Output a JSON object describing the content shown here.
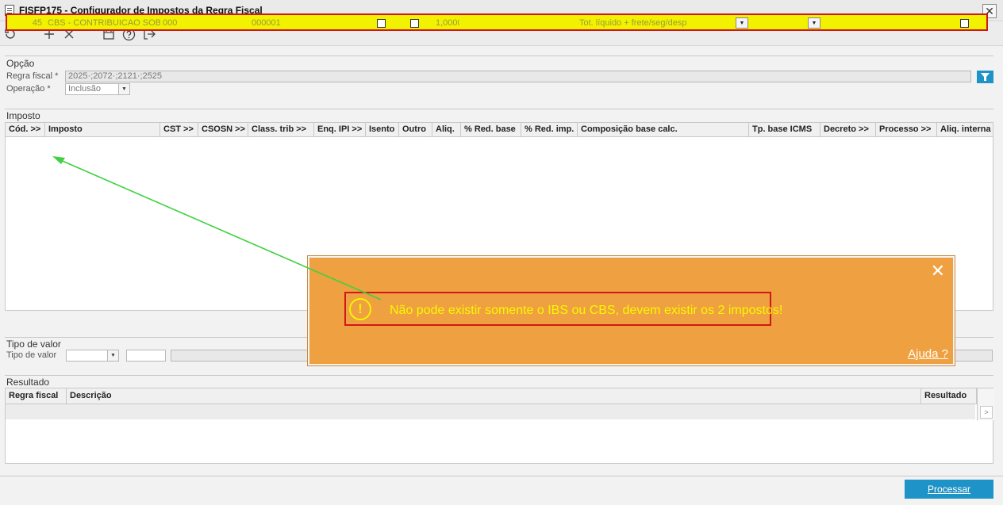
{
  "window": {
    "title": "FISFP175 - Configurador de Impostos da Regra Fiscal",
    "close_label": "✕"
  },
  "toolbar": {
    "icons": [
      "refresh-icon",
      "add-icon",
      "delete-icon",
      "calendar-icon",
      "help-icon",
      "exit-icon"
    ]
  },
  "opcao": {
    "section_title": "Opção",
    "regra_label": "Regra fiscal *",
    "regra_value": "2025·;2072·;2121·;2525",
    "operacao_label": "Operação *",
    "operacao_value": "Inclusão"
  },
  "imposto": {
    "section_title": "Imposto",
    "columns": [
      "Cód. >>",
      "Imposto",
      "CST >>",
      "CSOSN >>",
      "Class. trib >>",
      "Enq. IPI >>",
      "Isento",
      "Outro",
      "Aliq.",
      "% Red. base",
      "% Red. imp.",
      "Composição base calc.",
      "Tp. base ICMS",
      "Decreto >>",
      "Processo >>",
      "Aliq. interna"
    ],
    "row": {
      "cod": "45",
      "imposto": "CBS - CONTRIBUICAO SOBRE",
      "cst": "000",
      "class_trib": "000001",
      "aliq": "1,0000",
      "composicao": "Tot. líquido + frete/seg/desp"
    }
  },
  "tipo_valor": {
    "section_title": "Tipo de valor",
    "label": "Tipo de valor"
  },
  "resultado": {
    "section_title": "Resultado",
    "columns": [
      "Regra fiscal",
      "Descrição",
      "Resultado"
    ]
  },
  "actions": {
    "process_label": "Processar"
  },
  "alert": {
    "message": "Não pode existir somente o IBS ou CBS, devem existir os 2 impostos!",
    "help_label": "Ajuda ?",
    "background": "#efa040",
    "text_color": "#f8f800"
  }
}
